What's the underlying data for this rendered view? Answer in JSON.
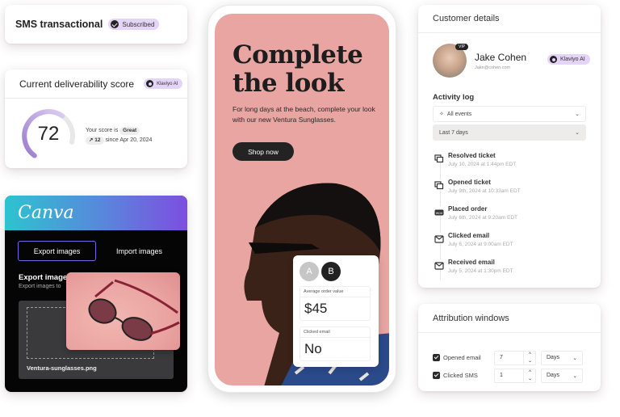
{
  "sms_card": {
    "title": "SMS transactional",
    "badge": "Subscribed",
    "badge_icon": "check-circle-icon"
  },
  "deliverability": {
    "title": "Current deliverability score",
    "ai_badge": "Klaviyo AI",
    "score": "72",
    "score_fraction": 0.72,
    "score_prefix": "Your score is",
    "rating": "Great",
    "change": "12",
    "change_icon": "trend-up-icon",
    "since": "since Apr 20, 2024",
    "gauge_color": "#9d7fd0",
    "gauge_track_color": "#e8e8e8"
  },
  "canva": {
    "logo": "Canva",
    "tabs": [
      {
        "label": "Export images",
        "active": true
      },
      {
        "label": "Import images",
        "active": false
      }
    ],
    "section_title": "Export images",
    "section_subtitle": "Export images to",
    "file_name": "Ventura-sunglasses.png",
    "gradient": [
      "#2cc4cf",
      "#5a85dc",
      "#7d4ee0"
    ]
  },
  "phone": {
    "headline_line1": "Complete",
    "headline_line2": "the look",
    "body": "For long days at the beach, complete your look with our new Ventura Sunglasses.",
    "cta": "Shop now",
    "background": "#e8a5a2"
  },
  "ab_test": {
    "variant_a": "A",
    "variant_b": "B",
    "metric1_label": "Average order value",
    "metric1_value": "$45",
    "metric2_label": "Clicked email",
    "metric2_value": "No"
  },
  "customer": {
    "title": "Customer details",
    "vip": "VIP",
    "name": "Jake Cohen",
    "email": "Jake@cohen.com",
    "ai_badge": "Klaviyo AI",
    "activity_title": "Activity log",
    "filter_events": "All events",
    "filter_range": "Last 7 days",
    "events": [
      {
        "title": "Resolved ticket",
        "date": "July 10, 2024 at 1:44pm EDT",
        "icon": "ticket-icon"
      },
      {
        "title": "Opened ticket",
        "date": "July 9th, 2024 at 10:33am EDT",
        "icon": "ticket-icon"
      },
      {
        "title": "Placed order",
        "date": "July 6th, 2024 at 9:20am EDT",
        "icon": "woo-icon"
      },
      {
        "title": "Clicked email",
        "date": "July 6, 2024 at 9:00am EDT",
        "icon": "email-icon"
      },
      {
        "title": "Received email",
        "date": "July 5, 2024 at 1:30pm EDT",
        "icon": "email-icon"
      }
    ]
  },
  "attribution": {
    "title": "Attribution windows",
    "rows": [
      {
        "label": "Opened email",
        "checked": true,
        "value": "7",
        "unit": "Days"
      },
      {
        "label": "Clicked SMS",
        "checked": true,
        "value": "1",
        "unit": "Days"
      }
    ]
  }
}
